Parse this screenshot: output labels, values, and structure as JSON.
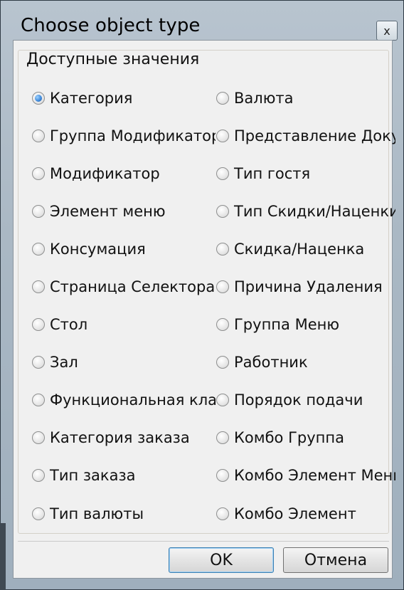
{
  "window": {
    "title": "Choose object type",
    "close_glyph": "x"
  },
  "group": {
    "title": "Доступные значения"
  },
  "options_left": [
    {
      "label": "Категория",
      "checked": true
    },
    {
      "label": "Группа Модификаторов",
      "checked": false
    },
    {
      "label": "Модификатор",
      "checked": false
    },
    {
      "label": "Элемент меню",
      "checked": false
    },
    {
      "label": "Консумация",
      "checked": false
    },
    {
      "label": "Страница Селектора",
      "checked": false
    },
    {
      "label": "Стол",
      "checked": false
    },
    {
      "label": "Зал",
      "checked": false
    },
    {
      "label": "Функциональная клавиша",
      "checked": false
    },
    {
      "label": "Категория заказа",
      "checked": false
    },
    {
      "label": "Тип заказа",
      "checked": false
    },
    {
      "label": "Тип валюты",
      "checked": false
    }
  ],
  "options_right": [
    {
      "label": "Валюта",
      "checked": false
    },
    {
      "label": "Представление Документа",
      "checked": false
    },
    {
      "label": "Тип гостя",
      "checked": false
    },
    {
      "label": "Тип Скидки/Наценки",
      "checked": false
    },
    {
      "label": "Скидка/Наценка",
      "checked": false
    },
    {
      "label": "Причина Удаления",
      "checked": false
    },
    {
      "label": "Группа Меню",
      "checked": false
    },
    {
      "label": "Работник",
      "checked": false
    },
    {
      "label": "Порядок подачи",
      "checked": false
    },
    {
      "label": "Комбо Группа",
      "checked": false
    },
    {
      "label": "Комбо Элемент Меню",
      "checked": false
    },
    {
      "label": "Комбо Элемент",
      "checked": false
    }
  ],
  "buttons": {
    "ok": "OK",
    "cancel": "Отмена"
  },
  "colors": {
    "accent": "#3b86d8",
    "titlebar": "#aab8c4"
  }
}
